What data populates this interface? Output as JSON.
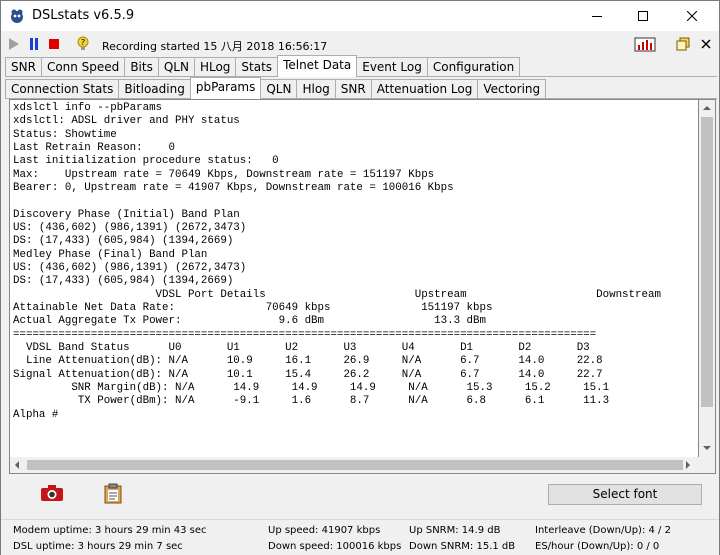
{
  "window": {
    "title": "DSLstats v6.5.9"
  },
  "toolbar": {
    "status": "Recording started 15 八月 2018 16:56:17"
  },
  "tabs_main": [
    "SNR",
    "Conn Speed",
    "Bits",
    "QLN",
    "HLog",
    "Stats",
    "Telnet Data",
    "Event Log",
    "Configuration"
  ],
  "tabs_main_active": "Telnet Data",
  "tabs_sub": [
    "Connection Stats",
    "Bitloading",
    "pbParams",
    "QLN",
    "Hlog",
    "SNR",
    "Attenuation Log",
    "Vectoring"
  ],
  "tabs_sub_active": "pbParams",
  "terminal": {
    "lines": [
      "xdslctl info --pbParams",
      "xdslctl: ADSL driver and PHY status",
      "Status: Showtime",
      "Last Retrain Reason:    0",
      "Last initialization procedure status:   0",
      "Max:    Upstream rate = 70649 Kbps, Downstream rate = 151197 Kbps",
      "Bearer: 0, Upstream rate = 41907 Kbps, Downstream rate = 100016 Kbps",
      "",
      "Discovery Phase (Initial) Band Plan",
      "US: (436,602) (986,1391) (2672,3473)",
      "DS: (17,433) (605,984) (1394,2669)",
      "Medley Phase (Final) Band Plan",
      "US: (436,602) (986,1391) (2672,3473)",
      "DS: (17,433) (605,984) (1394,2669)",
      "                      VDSL Port Details                       Upstream                    Downstream",
      "Attainable Net Data Rate:              70649 kbps              151197 kbps",
      "Actual Aggregate Tx Power:               9.6 dBm                 13.3 dBm",
      "==========================================================================================",
      "  VDSL Band Status      U0       U1       U2       U3       U4       D1       D2       D3",
      "  Line Attenuation(dB): N/A      10.9     16.1     26.9     N/A      6.7      14.0     22.8",
      "Signal Attenuation(dB): N/A      10.1     15.4     26.2     N/A      6.7      14.0     22.7",
      "         SNR Margin(dB): N/A      14.9     14.9     14.9     N/A      15.3     15.2     15.1",
      "          TX Power(dBm): N/A      -9.1     1.6      8.7      N/A      6.8      6.1      11.3",
      "Alpha #"
    ]
  },
  "buttons": {
    "select_font": "Select font"
  },
  "statusbar": {
    "modem_uptime": "Modem uptime:  3 hours 29 min 43 sec",
    "dsl_uptime": "DSL uptime:  3 hours 29 min 7 sec",
    "up_speed": "Up speed: 41907 kbps",
    "down_speed": "Down speed: 100016 kbps",
    "up_snrm": "Up SNRM: 14.9 dB",
    "down_snrm": "Down SNRM: 15.1 dB",
    "interleave": "Interleave (Down/Up): 4 / 2",
    "es_hour": "ES/hour (Down/Up): 0 / 0"
  },
  "colors": {
    "stop_red": "#e00000",
    "pause_blue": "#1a3fd4",
    "play_grey": "#a0a0a0"
  }
}
